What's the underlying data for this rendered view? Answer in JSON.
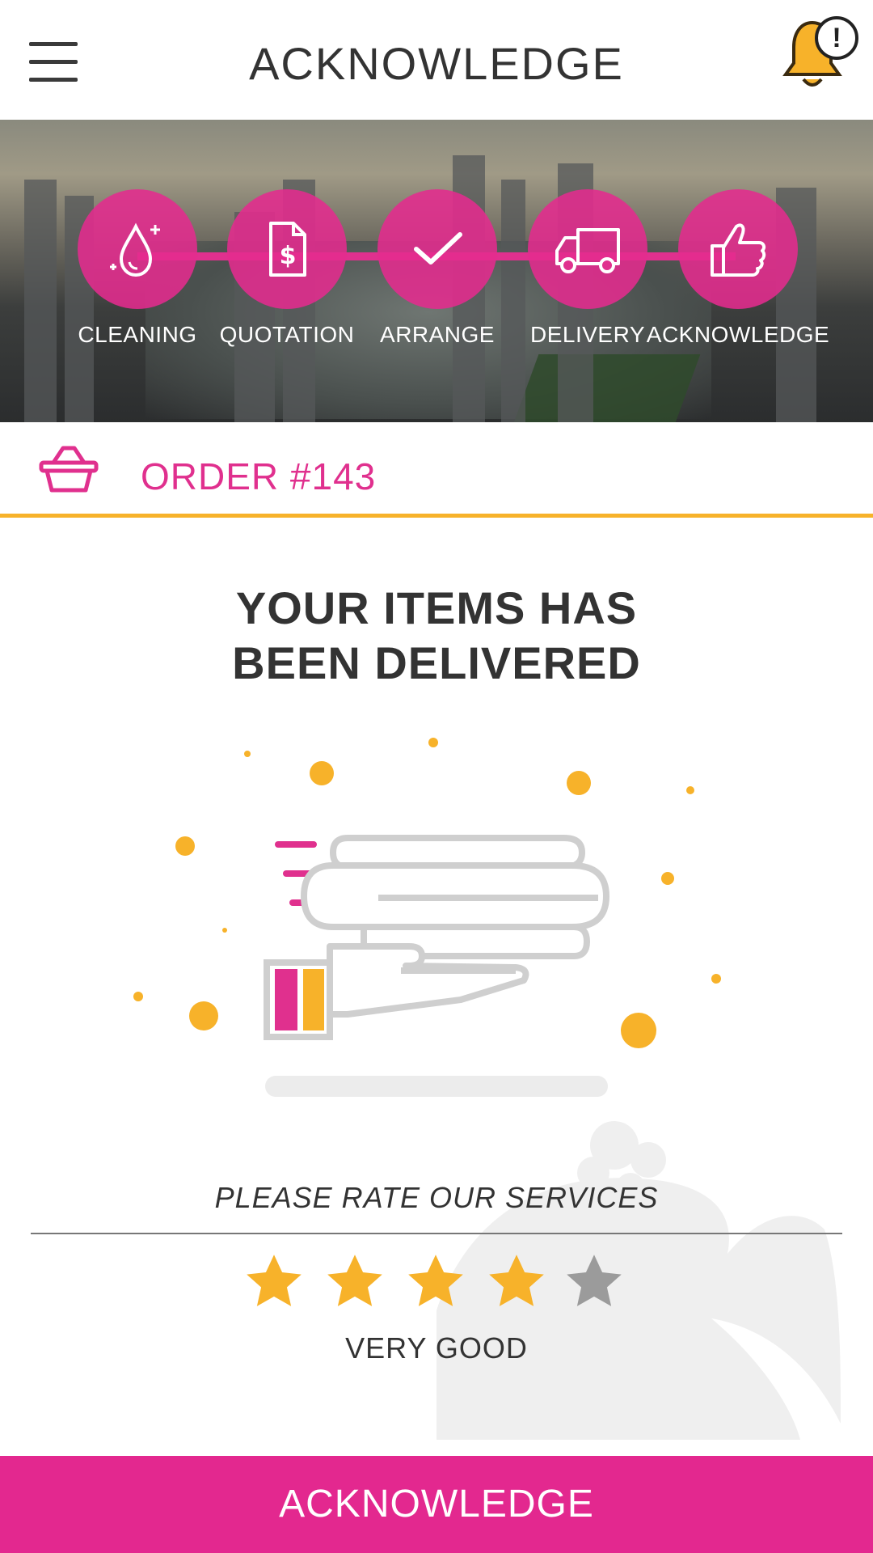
{
  "header": {
    "title": "ACKNOWLEDGE",
    "menu_icon": "hamburger-menu-icon",
    "notification_icon": "bell-icon",
    "notification_badge": "!"
  },
  "progress": {
    "steps": [
      {
        "label": "CLEANING",
        "icon": "water-drop-icon"
      },
      {
        "label": "QUOTATION",
        "icon": "dollar-document-icon"
      },
      {
        "label": "ARRANGE",
        "icon": "checkmark-icon"
      },
      {
        "label": "DELIVERY",
        "icon": "truck-icon"
      },
      {
        "label": "ACKNOWLEDGE",
        "icon": "thumbs-up-icon"
      }
    ]
  },
  "order": {
    "icon": "basket-icon",
    "title": "ORDER #143"
  },
  "status": {
    "line1": "YOUR ITEMS HAS",
    "line2": "BEEN DELIVERED"
  },
  "rating": {
    "prompt": "PLEASE RATE OUR SERVICES",
    "value": 4,
    "max": 5,
    "text": "VERY GOOD"
  },
  "actions": {
    "acknowledge_label": "ACKNOWLEDGE"
  },
  "colors": {
    "brand": "#e3288f",
    "accent": "#f7b22a",
    "star_on": "#f7b22a",
    "star_off": "#9b9b9b"
  }
}
